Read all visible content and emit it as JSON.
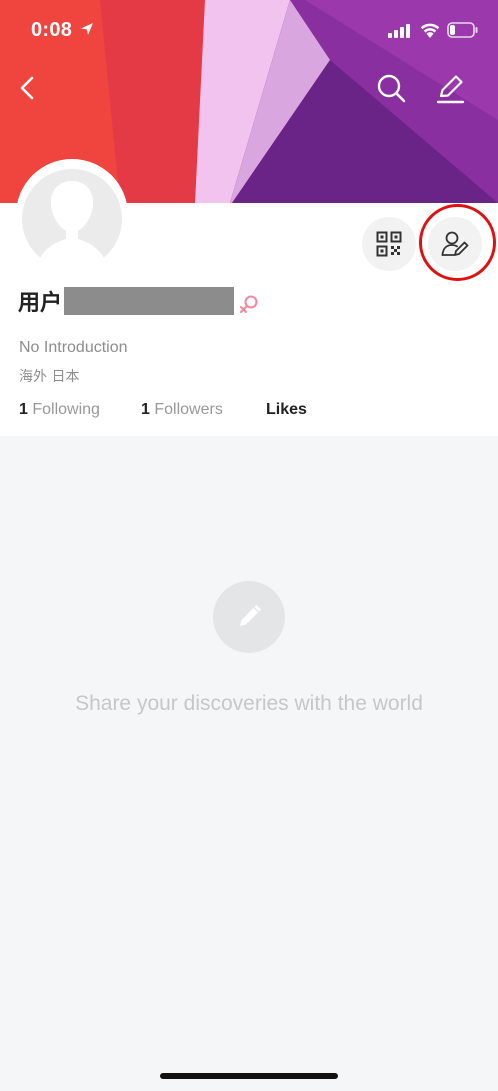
{
  "status_bar": {
    "time": "0:08"
  },
  "profile": {
    "username_prefix": "用户",
    "introduction": "No Introduction",
    "location": "海外 日本"
  },
  "stats": {
    "following_count": "1",
    "following_label": "Following",
    "followers_count": "1",
    "followers_label": "Followers",
    "likes_label": "Likes"
  },
  "empty_state": {
    "message": "Share your discoveries with the world"
  },
  "icons": {
    "back": "chevron-left-icon",
    "search": "search-icon",
    "edit": "pencil-icon",
    "qr": "qr-code-icon",
    "edit_profile": "user-edit-icon",
    "gender": "female-icon"
  },
  "colors": {
    "banner_red": "#f0443f",
    "banner_purple": "#8a2fa0",
    "highlight": "#e01010",
    "gender": "#f08a9a"
  }
}
